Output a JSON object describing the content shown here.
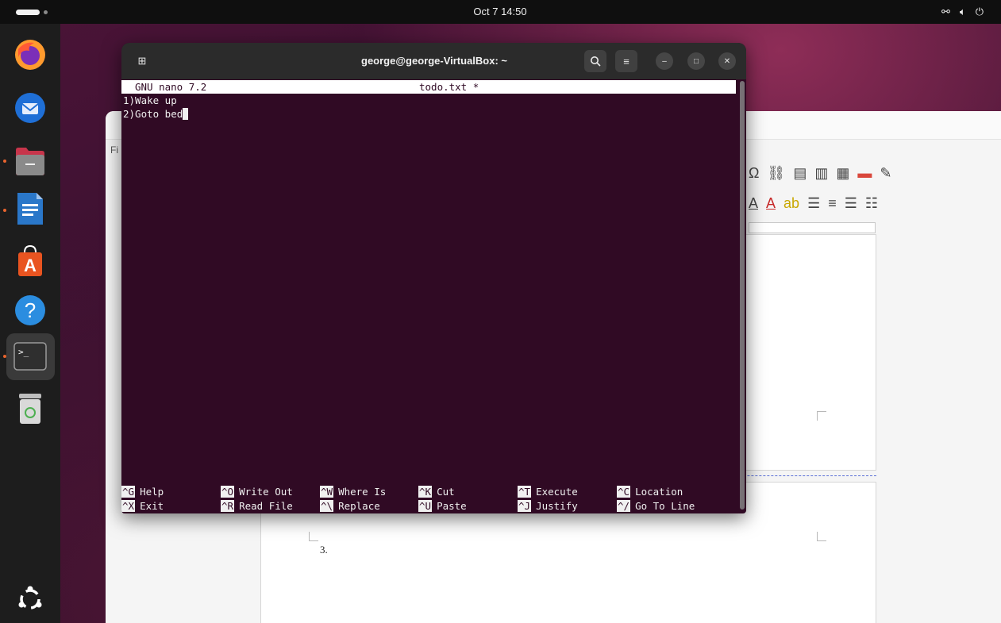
{
  "topbar": {
    "clock": "Oct 7  14:50"
  },
  "dock": {
    "items": [
      {
        "name": "firefox",
        "icon": "firefox-icon"
      },
      {
        "name": "thunderbird",
        "icon": "thunderbird-icon"
      },
      {
        "name": "files",
        "icon": "files-icon"
      },
      {
        "name": "libreoffice-writer",
        "icon": "writer-icon"
      },
      {
        "name": "app-center",
        "icon": "app-center-icon"
      },
      {
        "name": "help",
        "icon": "help-icon"
      },
      {
        "name": "terminal",
        "icon": "terminal-icon"
      },
      {
        "name": "trash",
        "icon": "trash-icon"
      },
      {
        "name": "show-apps",
        "icon": "ubuntu-logo-icon"
      }
    ]
  },
  "terminal": {
    "title": "george@george-VirtualBox: ~"
  },
  "nano": {
    "version": "GNU nano 7.2",
    "filename": "todo.txt *",
    "lines": [
      "1)Wake up",
      "2)Goto bed"
    ],
    "shortcuts": [
      {
        "key": "^G",
        "label": "Help"
      },
      {
        "key": "^X",
        "label": "Exit"
      },
      {
        "key": "^O",
        "label": "Write Out"
      },
      {
        "key": "^R",
        "label": "Read File"
      },
      {
        "key": "^W",
        "label": "Where Is"
      },
      {
        "key": "^\\",
        "label": "Replace"
      },
      {
        "key": "^K",
        "label": "Cut"
      },
      {
        "key": "^U",
        "label": "Paste"
      },
      {
        "key": "^T",
        "label": "Execute"
      },
      {
        "key": "^J",
        "label": "Justify"
      },
      {
        "key": "^C",
        "label": "Location"
      },
      {
        "key": "^/",
        "label": "Go To Line"
      }
    ]
  },
  "writer": {
    "menu_fragment": "Fi",
    "list_number": "3."
  },
  "colors": {
    "terminal_bg": "#300a24",
    "accent": "#e9642e"
  }
}
